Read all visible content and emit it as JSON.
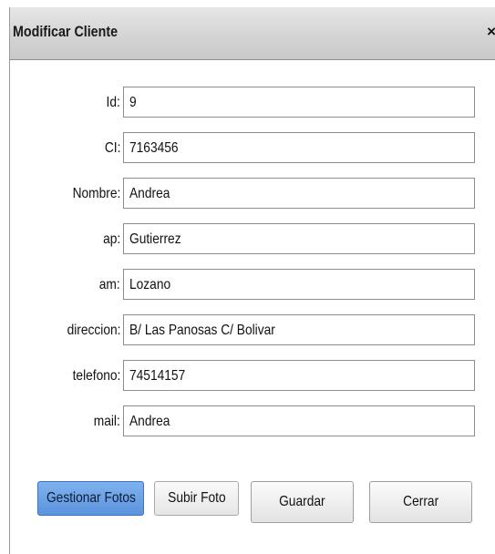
{
  "dialog": {
    "title": "Modificar Cliente",
    "close_label": "×"
  },
  "fields": [
    {
      "label": "Id:",
      "value": "9"
    },
    {
      "label": "CI:",
      "value": "7163456"
    },
    {
      "label": "Nombre:",
      "value": "Andrea"
    },
    {
      "label": "ap:",
      "value": "Gutierrez"
    },
    {
      "label": "am:",
      "value": "Lozano"
    },
    {
      "label": "direccion:",
      "value": "B/ Las Panosas C/ Bolivar"
    },
    {
      "label": "telefono:",
      "value": "74514157"
    },
    {
      "label": "mail:",
      "value": "Andrea"
    }
  ],
  "buttons": {
    "gestionar_fotos": "Gestionar Fotos",
    "subir_foto": "Subir Foto",
    "guardar": "Guardar",
    "cerrar": "Cerrar"
  },
  "colors": {
    "primary_button": "#5b94de",
    "titlebar": "#d7d7d7"
  }
}
